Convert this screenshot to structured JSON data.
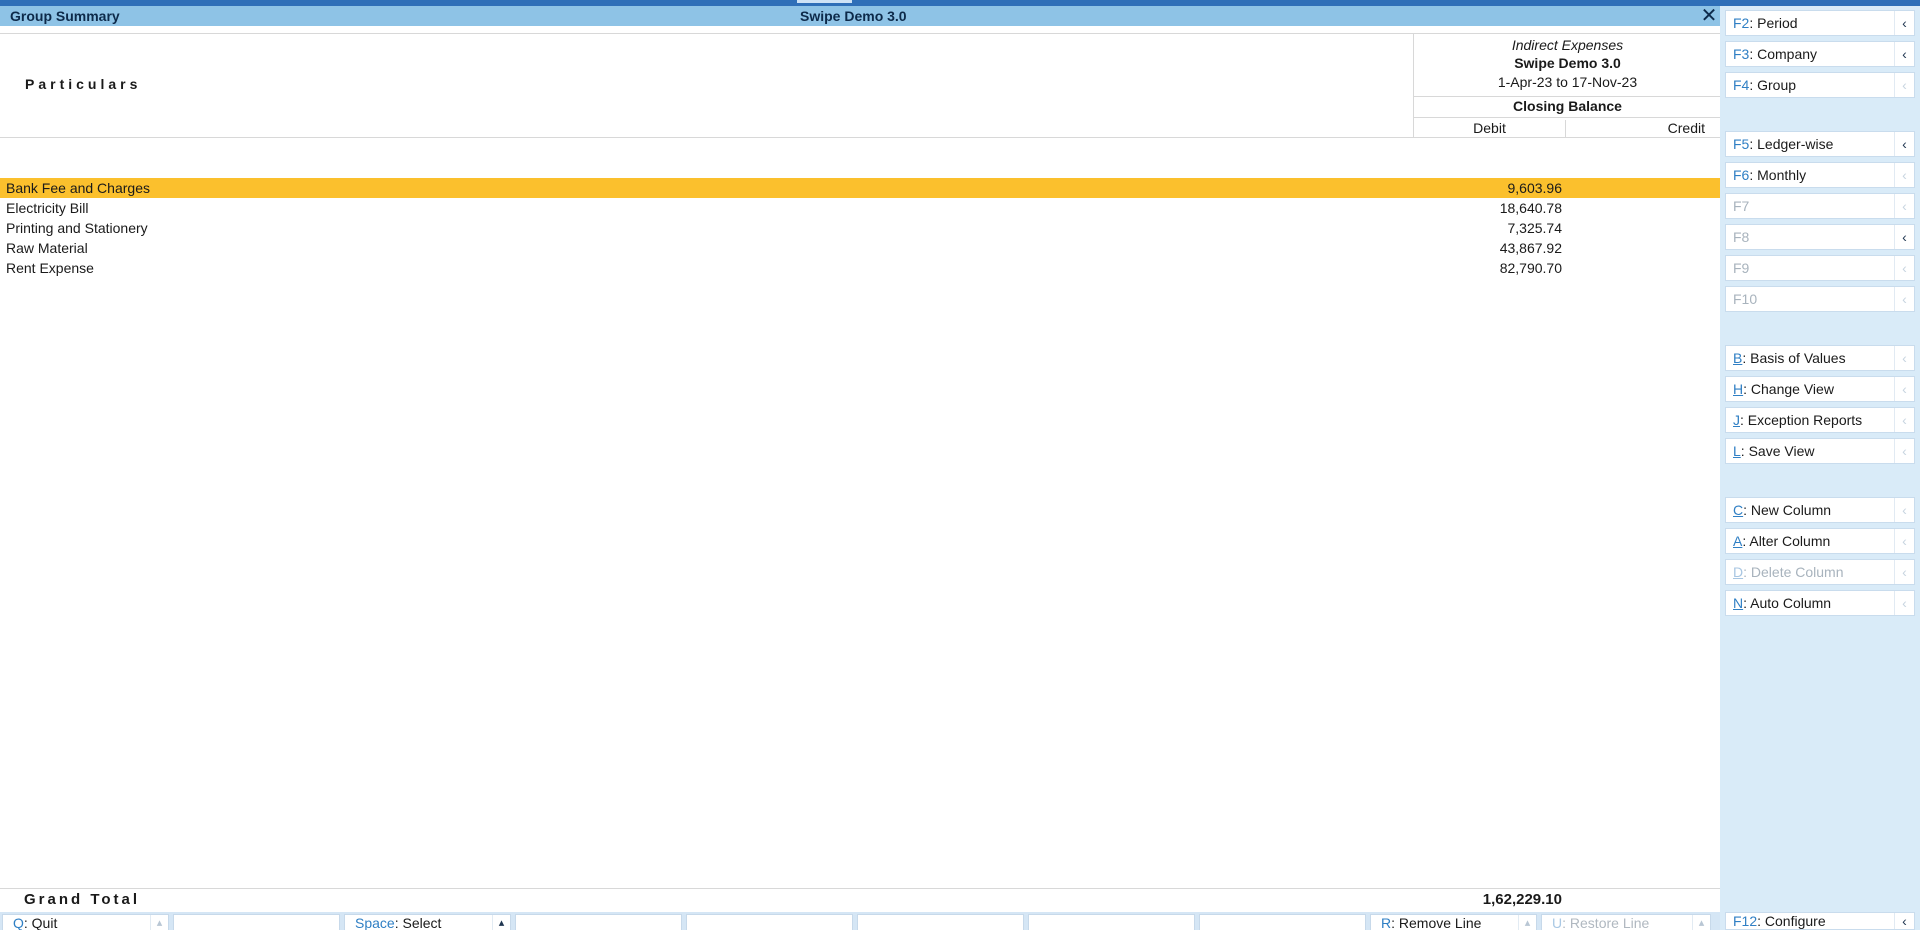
{
  "titlebar": {
    "left_title": "Group Summary",
    "company_title": "Swipe Demo 3.0",
    "close_glyph": "✕"
  },
  "header": {
    "particulars_label": "Particulars",
    "column": {
      "group_name": "Indirect Expenses",
      "company": "Swipe Demo 3.0",
      "period": "1-Apr-23 to 17-Nov-23",
      "balance_label": "Closing Balance",
      "debit_label": "Debit",
      "credit_label": "Credit"
    }
  },
  "rows": [
    {
      "name": "Bank Fee and Charges",
      "debit": "9,603.96",
      "selected": true
    },
    {
      "name": "Electricity Bill",
      "debit": "18,640.78",
      "selected": false
    },
    {
      "name": "Printing and Stationery",
      "debit": "7,325.74",
      "selected": false
    },
    {
      "name": "Raw Material",
      "debit": "43,867.92",
      "selected": false
    },
    {
      "name": "Rent Expense",
      "debit": "82,790.70",
      "selected": false
    }
  ],
  "grand_total": {
    "label": "Grand Total",
    "debit": "1,62,229.10"
  },
  "bottom_bar": {
    "quit": {
      "key": "Q",
      "label": "Quit"
    },
    "select": {
      "key": "Space",
      "label": "Select"
    },
    "remove_line": {
      "key": "R",
      "label": "Remove Line"
    },
    "restore_line": {
      "key": "U",
      "label": "Restore Line"
    },
    "configure": {
      "key": "F12",
      "label": "Configure"
    }
  },
  "right_panel": {
    "period": {
      "key": "F2",
      "label": "Period"
    },
    "company": {
      "key": "F3",
      "label": "Company"
    },
    "group": {
      "key": "F4",
      "label": "Group"
    },
    "ledger_wise": {
      "key": "F5",
      "label": "Ledger-wise"
    },
    "monthly": {
      "key": "F6",
      "label": "Monthly"
    },
    "f7": {
      "key": "F7"
    },
    "f8": {
      "key": "F8"
    },
    "f9": {
      "key": "F9"
    },
    "f10": {
      "key": "F10"
    },
    "basis_of_values": {
      "key": "B",
      "label": "Basis of Values"
    },
    "change_view": {
      "key": "H",
      "label": "Change View"
    },
    "exception_reports": {
      "key": "J",
      "label": "Exception Reports"
    },
    "save_view": {
      "key": "L",
      "label": "Save View"
    },
    "new_column": {
      "key": "C",
      "label": "New Column"
    },
    "alter_column": {
      "key": "A",
      "label": "Alter Column"
    },
    "delete_column": {
      "key": "D",
      "label": "Delete Column"
    },
    "auto_column": {
      "key": "N",
      "label": "Auto Column"
    }
  },
  "colors": {
    "selected_row": "#fbc02d",
    "titlebar": "#8ec3e6",
    "panel_bg": "#d9ebf8",
    "key_blue": "#2f7fc4"
  }
}
